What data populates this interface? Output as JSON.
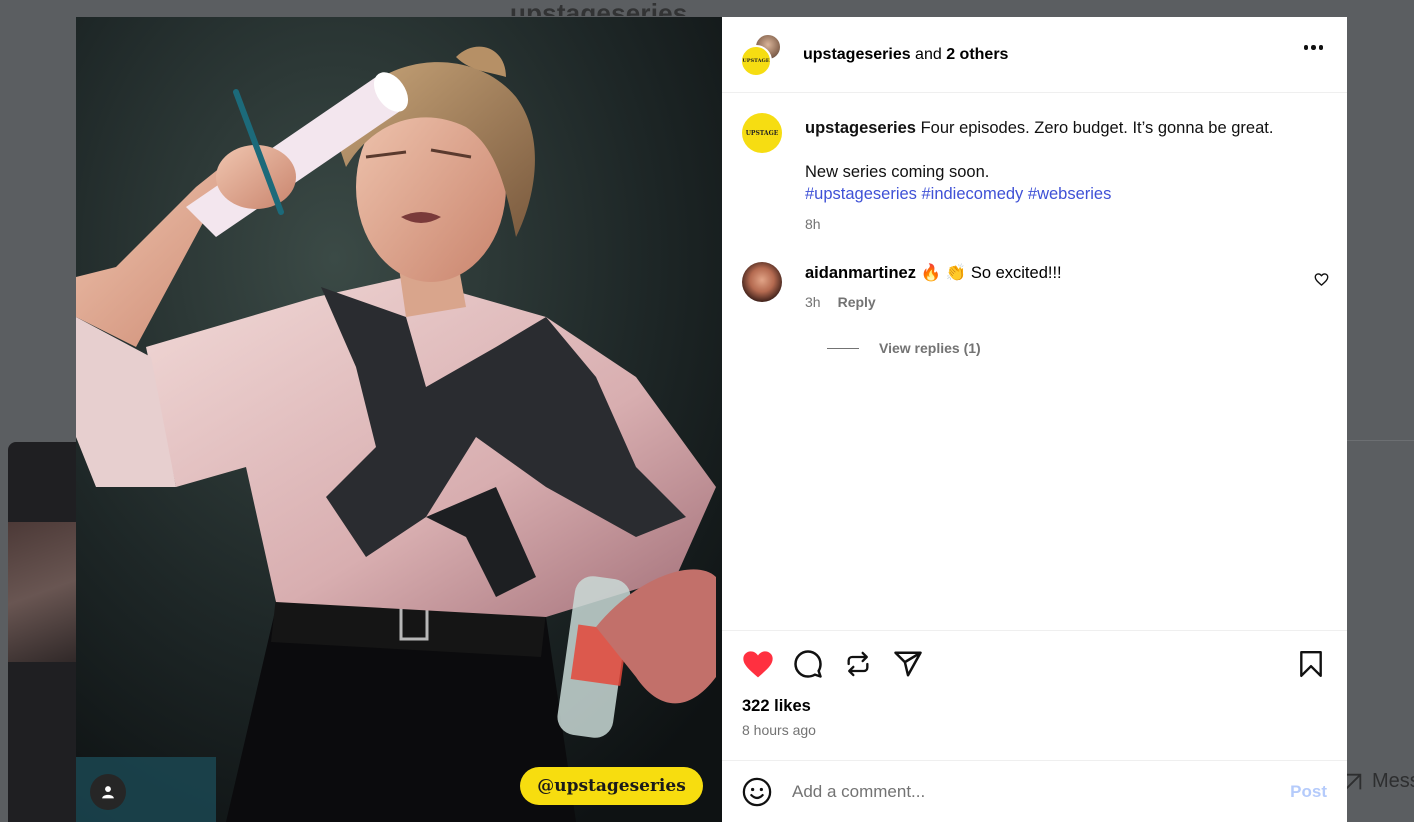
{
  "background": {
    "page_title": "upstageseries",
    "messages_label": "Mess"
  },
  "media": {
    "handle_badge": "@upstageseries",
    "logo_text": "UPSTAGE"
  },
  "header": {
    "username": "upstageseries",
    "and_text": " and ",
    "others": "2 others"
  },
  "caption": {
    "username": "upstageseries",
    "text": " Four episodes. Zero budget. It’s gonna be great.",
    "line2": "New series coming soon.",
    "hashtags": "#upstageseries #indiecomedy #webseries",
    "time": "8h"
  },
  "comment": {
    "username": "aidanmartinez",
    "emojis": "🔥 👏",
    "text": "So excited!!!",
    "time": "3h",
    "reply_label": "Reply",
    "view_replies": "View replies (1)"
  },
  "actions": {
    "likes": "322 likes",
    "time_ago": "8 hours ago"
  },
  "comment_box": {
    "placeholder": "Add a comment...",
    "post_label": "Post"
  },
  "colors": {
    "heart": "#ff3040",
    "hashtag": "#3f51d6",
    "post_disabled": "#b5cbfb",
    "badge_yellow": "#f7dd0f"
  }
}
